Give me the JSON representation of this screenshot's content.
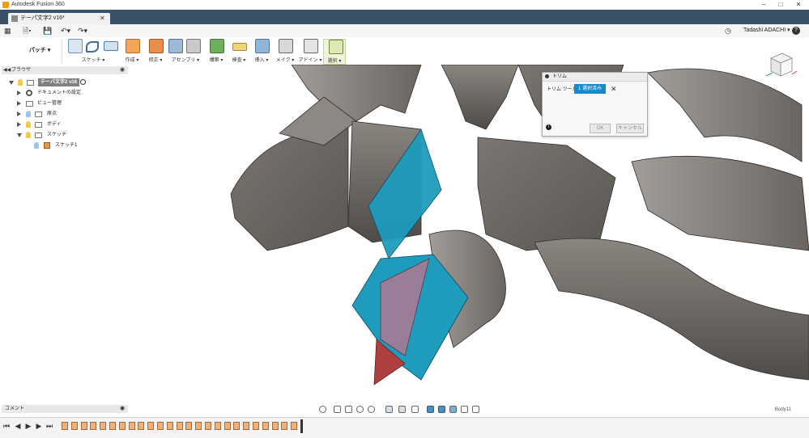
{
  "app": {
    "window_title": "Autodesk Fusion 360"
  },
  "tabs": [
    {
      "label": "テーパ文字2 v16*"
    }
  ],
  "user": {
    "name": "Tadashi ADACHI ▾",
    "help": "?"
  },
  "workspace": {
    "label": "パッチ ▾"
  },
  "ribbon_groups": [
    {
      "label": "スケッチ ▾"
    },
    {
      "label": "作成 ▾"
    },
    {
      "label": "修正 ▾"
    },
    {
      "label": "アセンブリ ▾"
    },
    {
      "label": "構築 ▾"
    },
    {
      "label": "検査 ▾"
    },
    {
      "label": "挿入 ▾"
    },
    {
      "label": "メイク ▾"
    },
    {
      "label": "アドイン ▾"
    },
    {
      "label": "選択 ▾"
    }
  ],
  "browser": {
    "title": "ブラウザ",
    "root": "テーパ文字2 v16",
    "items": [
      "ドキュメントの設定",
      "ビュー管理",
      "原点",
      "ボディ",
      "スケッチ"
    ],
    "sketch_child": "スケッチ1"
  },
  "dialog": {
    "title": "トリム",
    "tool_label": "トリム ツール",
    "selection": "1 選択済み",
    "ok": "OK",
    "cancel": "キャンセル"
  },
  "comments": {
    "label": "コメント"
  },
  "status": {
    "text": "Body11"
  },
  "colors": {
    "accent": "#1788c9",
    "tabbar": "#3b5168",
    "surface": "#6f6a66",
    "selected_body": "#1f9bbd",
    "sketch_region": "#b04040"
  }
}
